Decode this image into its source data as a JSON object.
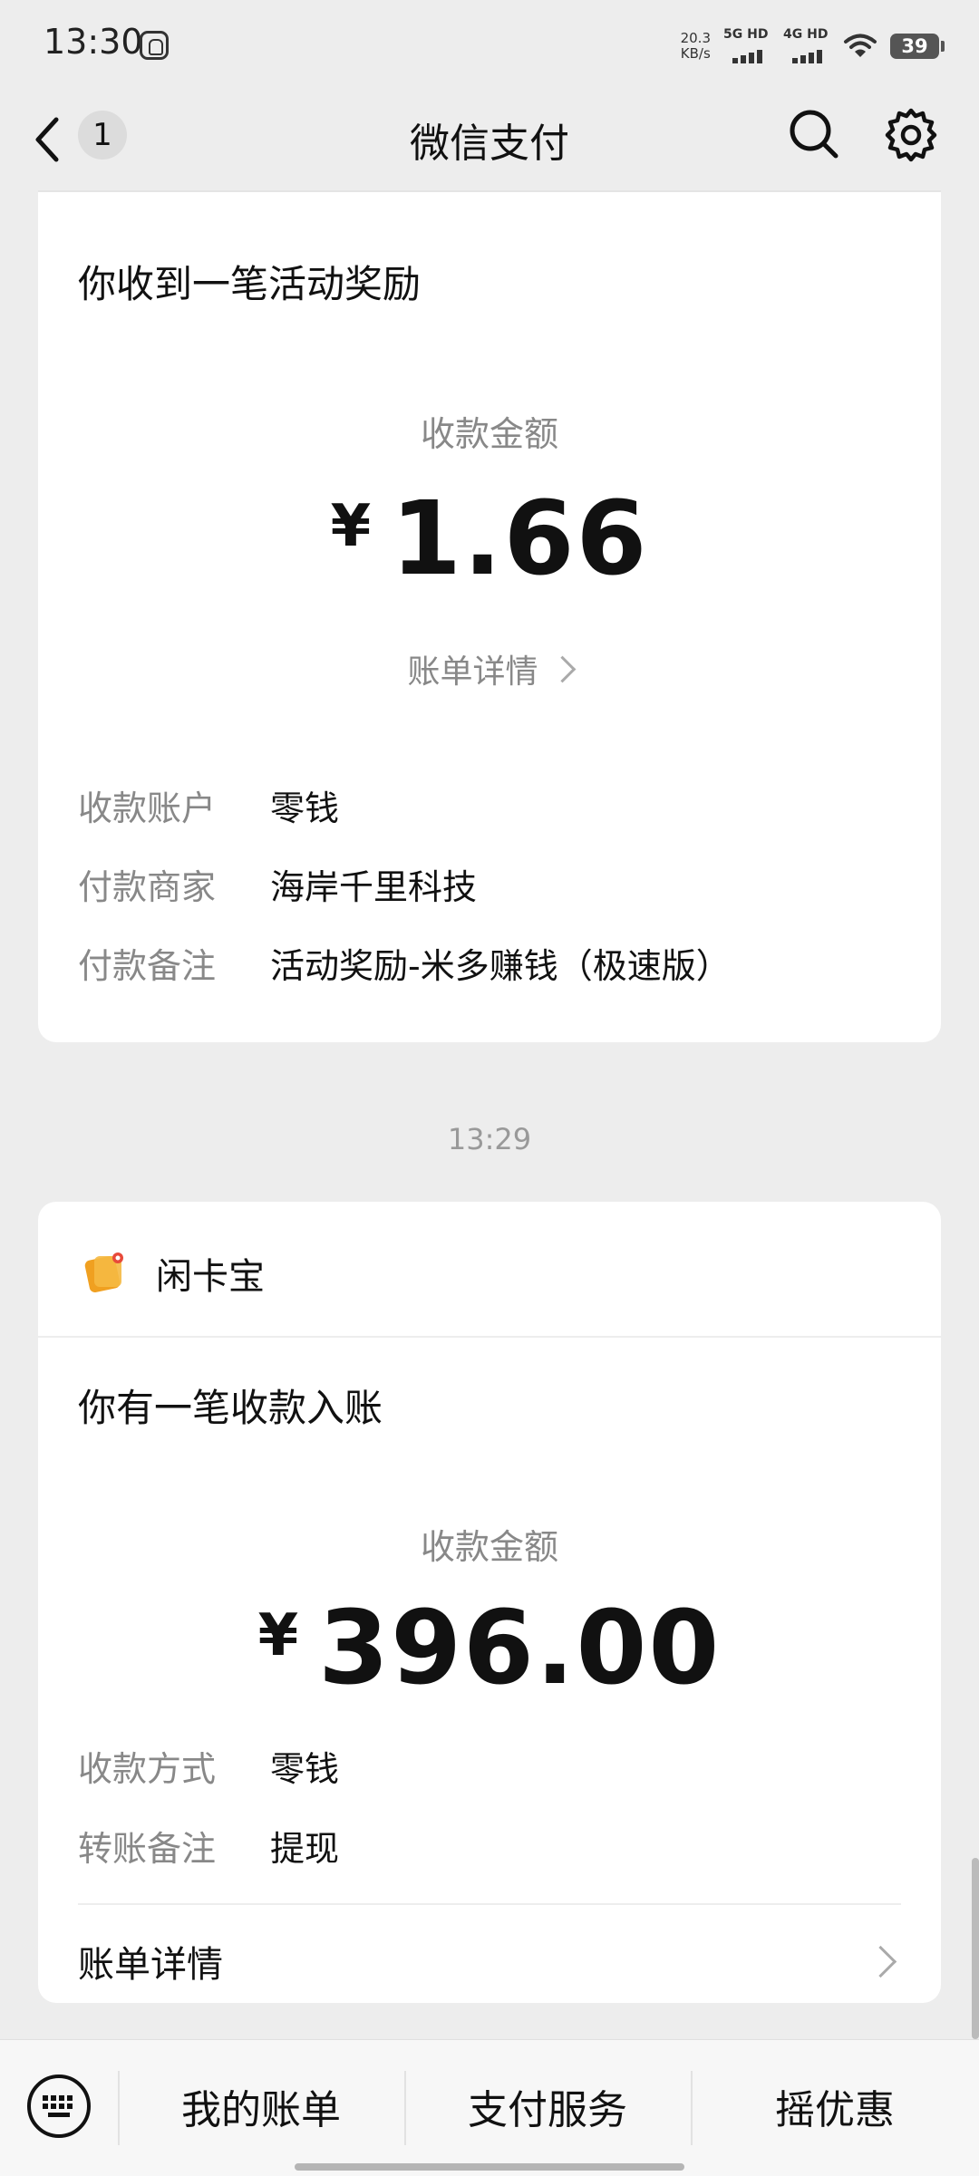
{
  "status_bar": {
    "time": "13:30",
    "speed_value": "20.3",
    "speed_unit": "KB/s",
    "net1": "5G HD",
    "net2": "4G HD",
    "battery": "39"
  },
  "nav": {
    "back_badge": "1",
    "title": "微信支付"
  },
  "card1": {
    "title": "你收到一笔活动奖励",
    "amount_label": "收款金额",
    "currency": "¥",
    "amount": "1.66",
    "detail_link": "账单详情",
    "rows": [
      {
        "key": "收款账户",
        "value": "零钱"
      },
      {
        "key": "付款商家",
        "value": "海岸千里科技"
      },
      {
        "key": "付款备注",
        "value": "活动奖励-米多赚钱（极速版）"
      }
    ]
  },
  "time_separator": "13:29",
  "card2": {
    "merchant": "闲卡宝",
    "title": "你有一笔收款入账",
    "amount_label": "收款金额",
    "currency": "¥",
    "amount": "396.00",
    "rows": [
      {
        "key": "收款方式",
        "value": "零钱"
      },
      {
        "key": "转账备注",
        "value": "提现"
      }
    ],
    "bill_details": "账单详情"
  },
  "bottom_bar": {
    "tabs": [
      "我的账单",
      "支付服务",
      "摇优惠"
    ]
  },
  "icons": {
    "back": "chevron-left-icon",
    "search": "search-icon",
    "settings": "gear-icon",
    "keyboard": "keyboard-icon",
    "merchant_logo": "merchant-logo-icon"
  }
}
